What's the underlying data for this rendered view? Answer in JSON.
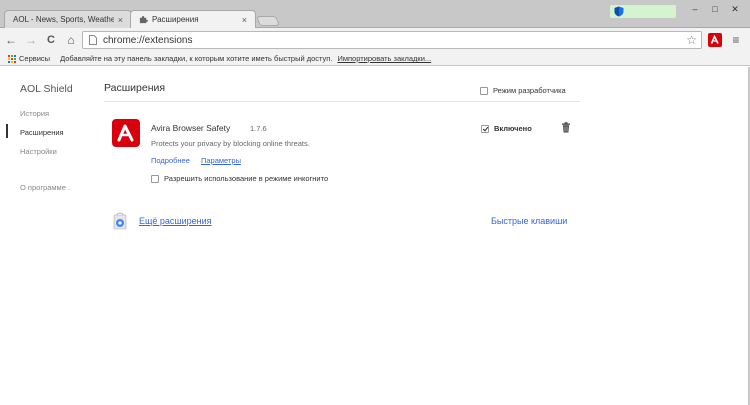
{
  "tabs": [
    {
      "label": "AOL - News, Sports, Weather",
      "close": "×"
    },
    {
      "label": "Расширения",
      "close": "×"
    }
  ],
  "window_controls": {
    "minimize": "–",
    "maximize": "□",
    "close": "✕"
  },
  "toolbar": {
    "back": "←",
    "forward": "→",
    "reload": "C",
    "home": "⌂",
    "url": "chrome://extensions",
    "star": "☆",
    "menu": "≡"
  },
  "bookmarks": {
    "apps_label": "Сервисы",
    "hint": "Добавляйте на эту панель закладки, к которым хотите иметь быстрый доступ.",
    "import_link": "Импортировать закладки..."
  },
  "sidebar": {
    "title": "AOL Shield",
    "items": [
      {
        "label": "История"
      },
      {
        "label": "Расширения"
      },
      {
        "label": "Настройки"
      },
      {
        "label": "О программе ."
      }
    ]
  },
  "main": {
    "title": "Расширения",
    "dev_mode_label": "Режим разработчика",
    "extension": {
      "name": "Avira Browser Safety",
      "version": "1.7.6",
      "description": "Protects your privacy by blocking online threats.",
      "details_link": "Подробнее",
      "options_link": "Параметры",
      "incognito_label": "Разрешить использование в режиме инкогнито",
      "enabled_label": "Включено"
    },
    "more_extensions": "Ещё расширения",
    "keyboard_shortcuts": "Быстрые клавиши"
  },
  "colors": {
    "accent": "#d9000d",
    "link": "#3367d6",
    "shield": "#1a73e8",
    "profile_badge": "#d6f3d0"
  }
}
